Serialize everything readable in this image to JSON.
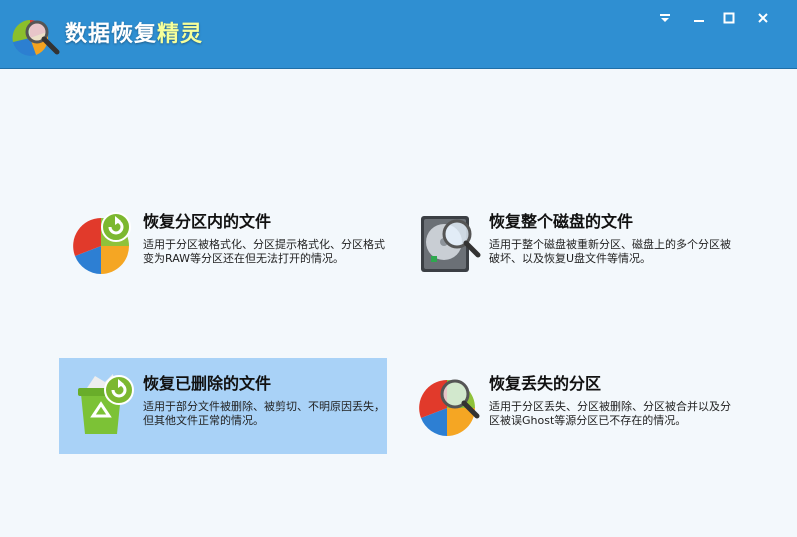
{
  "window": {
    "title_main": "数据恢复",
    "title_accent": "精灵"
  },
  "icons": {
    "app_logo": "magnifier-pie-logo",
    "menu": "menu-dropdown-icon",
    "minimize": "minimize-icon",
    "maximize": "maximize-icon",
    "close": "close-icon"
  },
  "options": [
    {
      "title": "恢复分区内的文件",
      "desc": "适用于分区被格式化、分区提示格式化、分区格式变为RAW等分区还在但无法打开的情况。",
      "icon": "pie-refresh-icon"
    },
    {
      "title": "恢复整个磁盘的文件",
      "desc": "适用于整个磁盘被重新分区、磁盘上的多个分区被破坏、以及恢复U盘文件等情况。",
      "icon": "hard-disk-magnifier-icon"
    },
    {
      "title": "恢复已删除的文件",
      "desc": "适用于部分文件被删除、被剪切、不明原因丢失，但其他文件正常的情况。",
      "icon": "recycle-bin-refresh-icon",
      "selected": true
    },
    {
      "title": "恢复丢失的分区",
      "desc": "适用于分区丢失、分区被删除、分区被合并以及分区被误Ghost等源分区已不存在的情况。",
      "icon": "pie-magnifier-icon"
    }
  ],
  "colors": {
    "titlebar": "#2f8fd2",
    "background": "#f3f8fc",
    "selected": "#a9d2f7"
  }
}
